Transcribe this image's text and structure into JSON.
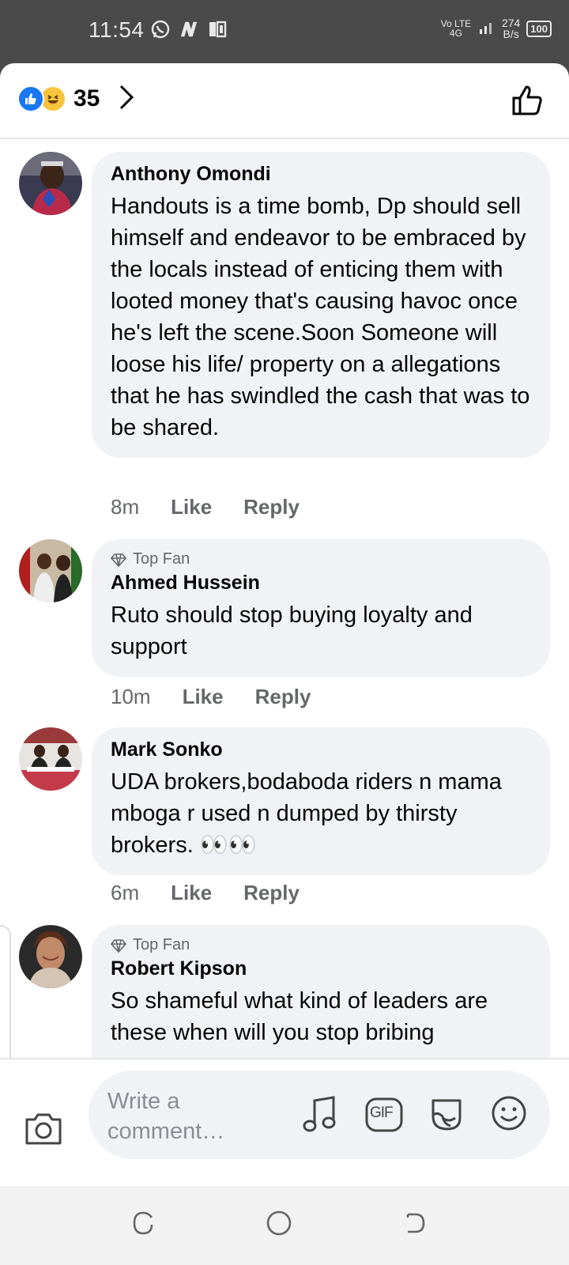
{
  "status_bar": {
    "time": "11:54",
    "network": "Vo LTE 4G",
    "speed_value": "274",
    "speed_unit": "B/s",
    "battery": "100"
  },
  "reactions": {
    "count": "35",
    "icons": [
      "like-reaction-icon",
      "haha-reaction-icon"
    ]
  },
  "comments": [
    {
      "top_fan": false,
      "author": "Anthony Omondi",
      "text": "Handouts is a time bomb, Dp should sell himself and endeavor to be embraced by the locals instead of enticing them with looted money that's causing havoc once he's left the scene.Soon Someone will loose his life/ property on a allegations that he has swindled the cash that was to be shared.",
      "time": "8m",
      "like": "Like",
      "reply": "Reply"
    },
    {
      "top_fan": true,
      "badge": "Top Fan",
      "author": "Ahmed Hussein",
      "text": "Ruto should stop buying loyalty and support",
      "time": "10m",
      "like": "Like",
      "reply": "Reply"
    },
    {
      "top_fan": false,
      "author": "Mark Sonko",
      "text": "UDA brokers,bodaboda riders n mama mboga r used n dumped by thirsty brokers. 👀👀",
      "time": "6m",
      "like": "Like",
      "reply": "Reply"
    },
    {
      "top_fan": true,
      "badge": "Top Fan",
      "author": "Robert Kipson",
      "text": "So shameful what  kind of leaders are these when will you stop bribing"
    }
  ],
  "composer": {
    "placeholder": "Write a comment…",
    "gif_label": "GIF"
  },
  "colors": {
    "accent": "#1877f2",
    "bubble": "#f0f2f5",
    "muted": "#65676b"
  }
}
